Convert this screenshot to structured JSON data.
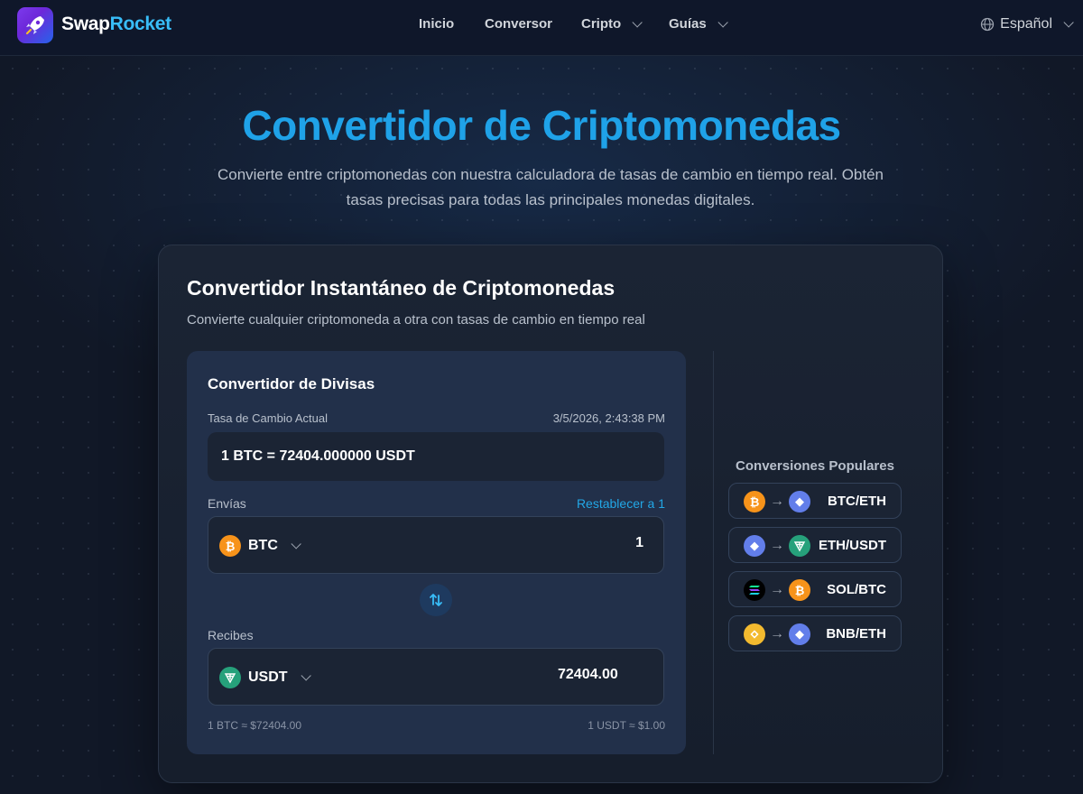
{
  "nav": {
    "brand_part1": "Swap",
    "brand_part2": "Rocket",
    "items": [
      {
        "label": "Inicio",
        "dropdown": false
      },
      {
        "label": "Conversor",
        "dropdown": false
      },
      {
        "label": "Cripto",
        "dropdown": true
      },
      {
        "label": "Guías",
        "dropdown": true
      }
    ],
    "language": "Español"
  },
  "hero": {
    "title": "Convertidor de Criptomonedas",
    "subtitle": "Convierte entre criptomonedas con nuestra calculadora de tasas de cambio en tiempo real. Obtén tasas precisas para todas las principales monedas digitales."
  },
  "card": {
    "title": "Convertidor Instantáneo de Criptomonedas",
    "subtitle": "Convierte cualquier criptomoneda a otra con tasas de cambio en tiempo real"
  },
  "converter": {
    "title": "Convertidor de Divisas",
    "rate_label": "Tasa de Cambio Actual",
    "rate_timestamp": "3/5/2026, 2:43:38 PM",
    "rate_value": "1 BTC = 72404.000000 USDT",
    "send_label": "Envías",
    "reset_link": "Restablecer a 1",
    "send_coin": "BTC",
    "send_amount": "1",
    "receive_label": "Recibes",
    "receive_coin": "USDT",
    "receive_amount": "72404.00",
    "footer_left": "1 BTC ≈ $72404.00",
    "footer_right": "1 USDT ≈ $1.00"
  },
  "popular": {
    "title": "Conversiones Populares",
    "items": [
      {
        "label": "BTC/ETH",
        "from_icon": "bitcoin-icon",
        "to_icon": "ethereum-icon"
      },
      {
        "label": "ETH/USDT",
        "from_icon": "ethereum-icon",
        "to_icon": "tether-icon"
      },
      {
        "label": "SOL/BTC",
        "from_icon": "solana-icon",
        "to_icon": "bitcoin-icon"
      },
      {
        "label": "BNB/ETH",
        "from_icon": "bnb-icon",
        "to_icon": "ethereum-icon"
      }
    ]
  },
  "colors": {
    "accent": "#1fa2e8",
    "btc": "#f7931a",
    "eth": "#627eea",
    "usdt": "#26a17b",
    "bnb": "#f3ba2f",
    "sol": "#14f195"
  }
}
